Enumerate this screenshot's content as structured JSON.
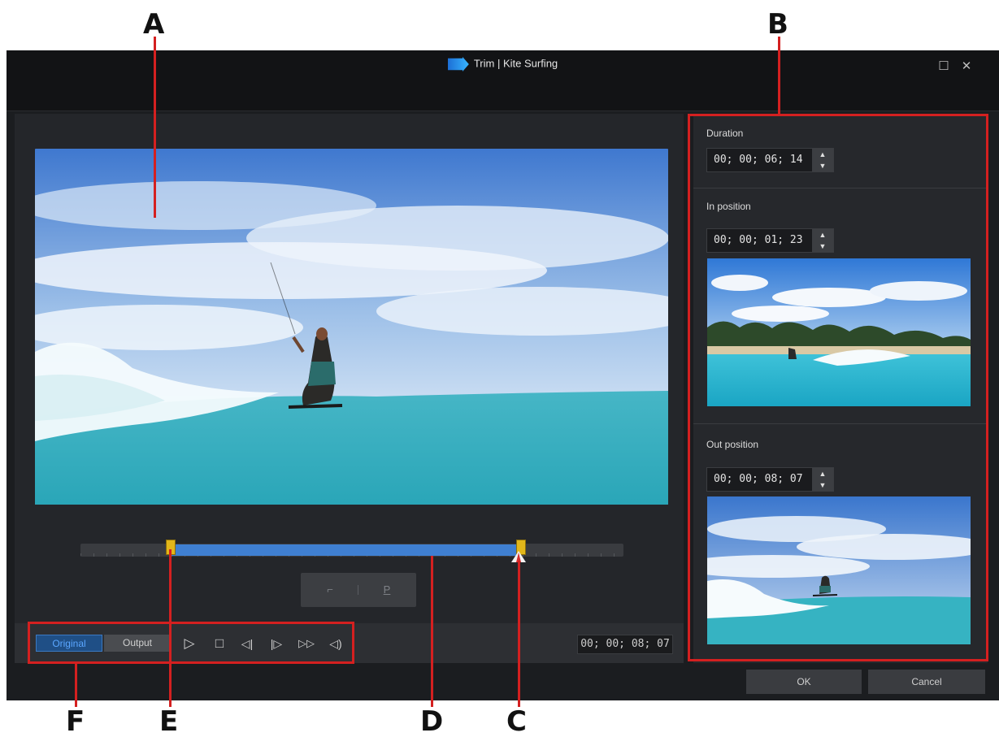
{
  "window": {
    "title": "Trim | Kite Surfing",
    "maximize_glyph": "☐",
    "close_glyph": "✕"
  },
  "callouts": [
    "A",
    "B",
    "C",
    "D",
    "E",
    "F"
  ],
  "right_panel": {
    "duration": {
      "label": "Duration",
      "value": "00; 00; 06; 14"
    },
    "in_position": {
      "label": "In position",
      "value": "00; 00; 01; 23"
    },
    "out_position": {
      "label": "Out position",
      "value": "00; 00; 08; 07"
    }
  },
  "mark_buttons": {
    "mark_in": "⌐",
    "mark_out": "P"
  },
  "control_bar": {
    "tab_original": "Original",
    "tab_output": "Output",
    "play": "▷",
    "stop": "□",
    "prev_frame": "◁|",
    "next_frame": "|▷",
    "fast_forward": "▷▷",
    "volume": "◁)",
    "timecode": "00; 00; 08; 07"
  },
  "dialog_buttons": {
    "ok": "OK",
    "cancel": "Cancel"
  },
  "trim": {
    "in_fraction": 0.165,
    "out_fraction": 0.81
  },
  "colors": {
    "callout_red": "#d42020",
    "accent_blue": "#3f7fd1",
    "handle_yellow": "#e2b71a"
  },
  "icons": [
    "app-icon",
    "maximize-icon",
    "close-icon",
    "spin-up-icon",
    "spin-down-icon",
    "play-icon",
    "stop-icon",
    "previous-frame-icon",
    "next-frame-icon",
    "fast-forward-icon",
    "volume-icon"
  ]
}
